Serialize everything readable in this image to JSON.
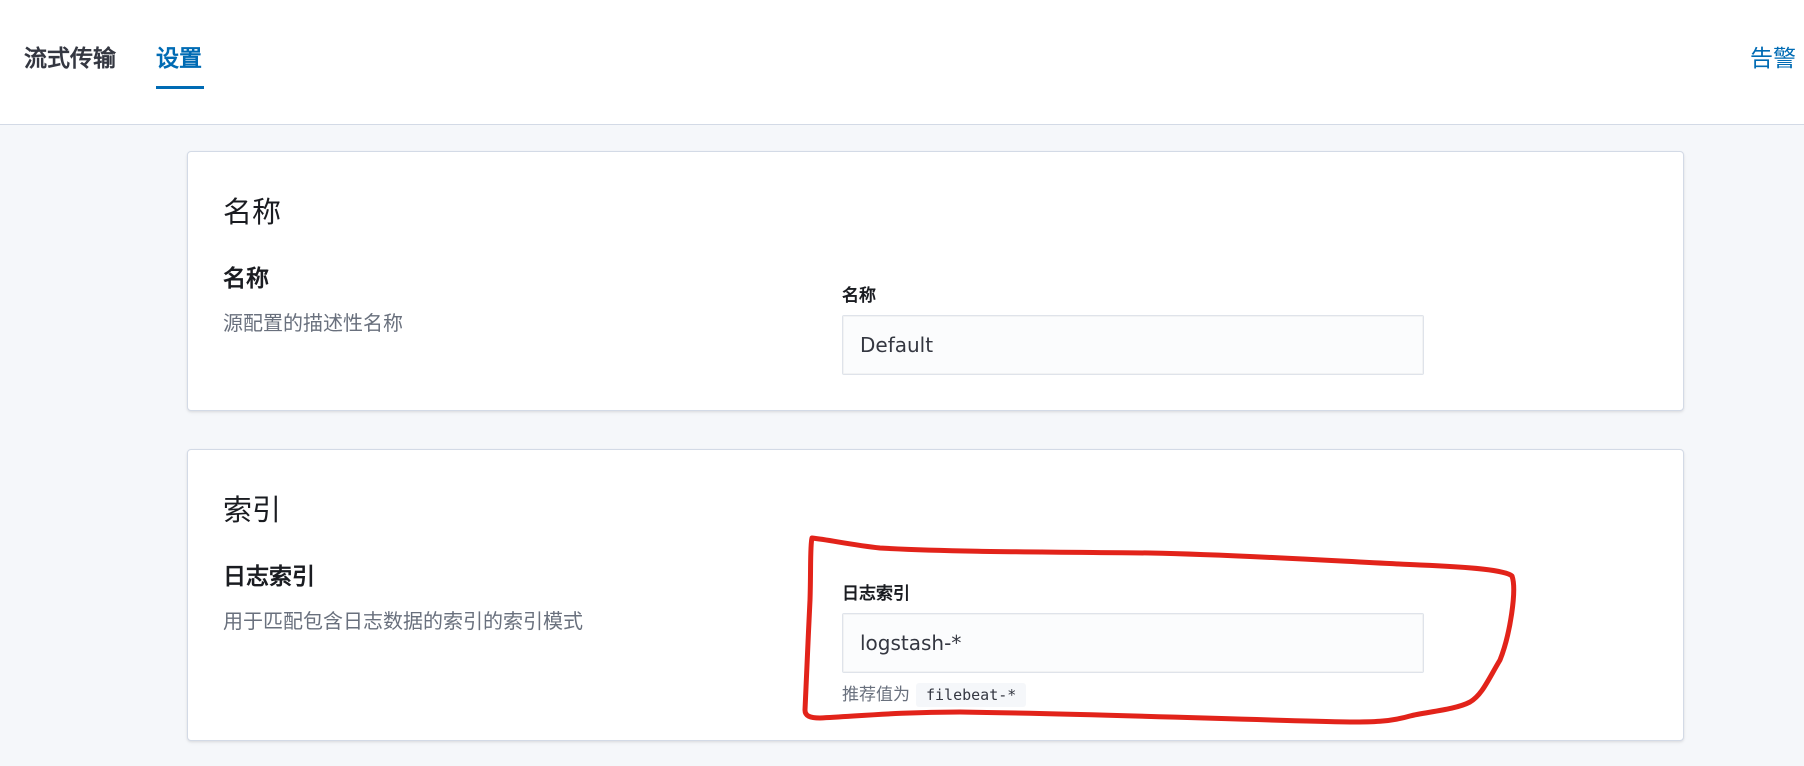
{
  "header": {
    "tabs": [
      {
        "label": "流式传输"
      },
      {
        "label": "设置",
        "active": true
      }
    ],
    "alerts_label": "告警"
  },
  "name_section": {
    "title": "名称",
    "field_title": "名称",
    "field_description": "源配置的描述性名称",
    "input_label": "名称",
    "input_value": "Default"
  },
  "index_section": {
    "title": "索引",
    "field_title": "日志索引",
    "field_description": "用于匹配包含日志数据的索引的索引模式",
    "input_label": "日志索引",
    "input_value": "logstash-*",
    "help_prefix": "推荐值为",
    "help_code": "filebeat-*"
  },
  "colors": {
    "accent": "#006bb4",
    "annotation": "#e2231a"
  }
}
